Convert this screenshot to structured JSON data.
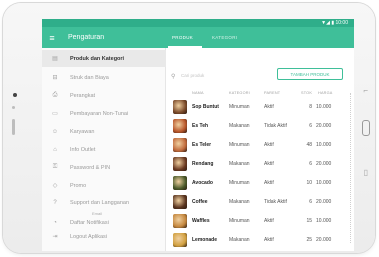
{
  "device": {
    "status_text": "▼◢ ▮ 10:00"
  },
  "appbar": {
    "title": "Pengaturan",
    "tabs": [
      {
        "label": "PRODUK",
        "active": true
      },
      {
        "label": "KATEGORI",
        "active": false
      }
    ]
  },
  "sidebar": {
    "items": [
      {
        "label": "Produk dan Kategori",
        "icon": "box-icon",
        "active": true
      },
      {
        "label": "Struk dan Biaya",
        "icon": "receipt-icon"
      },
      {
        "label": "Perangkat",
        "icon": "printer-icon"
      },
      {
        "label": "Pembayaran Non-Tunai",
        "icon": "card-icon"
      },
      {
        "label": "Karyawan",
        "icon": "people-icon"
      },
      {
        "label": "Info Outlet",
        "icon": "store-icon"
      },
      {
        "label": "Password & PIN",
        "icon": "lock-icon"
      },
      {
        "label": "Promo",
        "icon": "tag-icon"
      },
      {
        "label": "Support dan Langganan",
        "icon": "help-icon",
        "sub": "Email"
      },
      {
        "label": "Daftar Notifikasi",
        "icon": "bell-icon"
      },
      {
        "label": "Logout Aplikasi",
        "icon": "logout-icon"
      }
    ]
  },
  "search": {
    "placeholder": "Cari produk"
  },
  "add_button": {
    "label": "TAMBAH PRODUK"
  },
  "table": {
    "headers": [
      "NAMA",
      "KATEGORI",
      "PARENT",
      "STOK",
      "HARGA"
    ],
    "rows": [
      {
        "name": "Sop Buntut",
        "category": "Minuman",
        "parent": "Aktif",
        "stock": "8",
        "price": "10.000",
        "thumb_color": "#7a4a2a"
      },
      {
        "name": "Es Teh",
        "category": "Makanan",
        "parent": "Tidak Aktif",
        "stock": "6",
        "price": "20.000",
        "thumb_color": "#b8562a"
      },
      {
        "name": "Es Teler",
        "category": "Minuman",
        "parent": "Aktif",
        "stock": "48",
        "price": "10.000",
        "thumb_color": "#c06a3c"
      },
      {
        "name": "Rendang",
        "category": "Makanan",
        "parent": "Aktif",
        "stock": "6",
        "price": "20.000",
        "thumb_color": "#6b3a22"
      },
      {
        "name": "Avocado",
        "category": "Minuman",
        "parent": "Aktif",
        "stock": "10",
        "price": "10.000",
        "thumb_color": "#4a5a2a"
      },
      {
        "name": "Coffee",
        "category": "Makanan",
        "parent": "Tidak Aktif",
        "stock": "6",
        "price": "20.000",
        "thumb_color": "#5a3520"
      },
      {
        "name": "Waffles",
        "category": "Minuman",
        "parent": "Aktif",
        "stock": "15",
        "price": "10.000",
        "thumb_color": "#c4873e"
      },
      {
        "name": "Lemonade",
        "category": "Makanan",
        "parent": "Aktif",
        "stock": "25",
        "price": "20.000",
        "thumb_color": "#d1a040"
      }
    ]
  },
  "colors": {
    "accent": "#3fbf99",
    "status": "#2fae8a"
  }
}
